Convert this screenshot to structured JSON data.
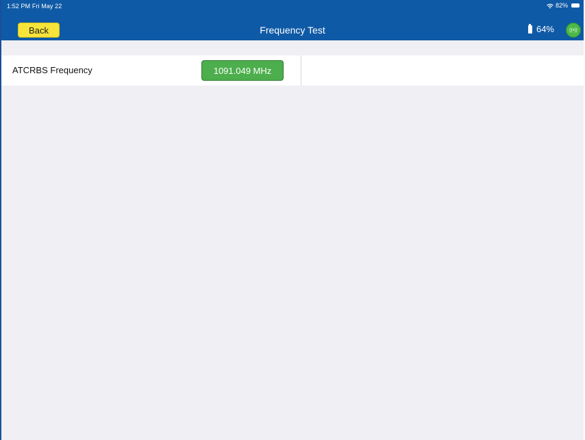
{
  "status_bar": {
    "time": "1:52 PM  Fri May 22",
    "battery_percent": "82%"
  },
  "nav": {
    "back_label": "Back",
    "title": "Frequency Test",
    "device_battery": "64%",
    "connection_icon": "((•))"
  },
  "rows": [
    {
      "label": "ATCRBS Frequency",
      "value": "1091.049 MHz"
    }
  ],
  "colors": {
    "nav_blue": "#0f5aa6",
    "back_yellow": "#f7e43a",
    "value_green": "#4cae4c",
    "background": "#efeff4"
  }
}
